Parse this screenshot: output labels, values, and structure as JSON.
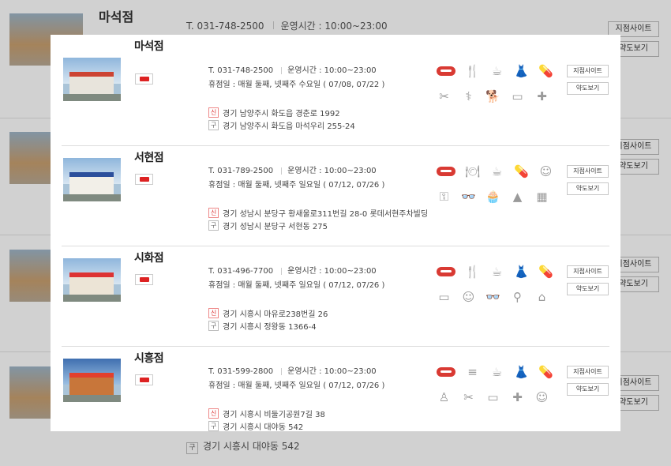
{
  "background": {
    "store_name": "마석점",
    "phone": "T. 031-748-2500",
    "hours": "운영시간 : 10:00~23:00",
    "buttons": {
      "site": "지점사이트",
      "map": "약도보기"
    },
    "addr_badge_old": "구",
    "addr_old": "경기 시흥시 대야동 542"
  },
  "stores": [
    {
      "name": "마석점",
      "phone": "T. 031-748-2500",
      "hours": "운영시간 : 10:00~23:00",
      "holiday": "휴점일 : 매월 둘째, 넷째주 수요일 ( 07/08, 07/22 )",
      "addr_new_badge": "신",
      "addr_new": "경기 남양주시 화도읍 경춘로 1992",
      "addr_old_badge": "구",
      "addr_old": "경기 남양주시 화도읍 마석우리 255-24",
      "icons_r1": [
        "himart-logo",
        "restaurant-icon",
        "cafe-icon",
        "fashion-icon",
        "pharmacy-icon"
      ],
      "icons_r2": [
        "beauty-icon",
        "clinic-icon",
        "pet-icon",
        "bandage-icon",
        "hospital-icon"
      ],
      "btn_site": "지점사이트",
      "btn_map": "약도보기"
    },
    {
      "name": "서현점",
      "phone": "T. 031-789-2500",
      "hours": "운영시간 : 10:00~23:00",
      "holiday": "휴점일 : 매월 둘째, 넷째주 일요일 ( 07/12, 07/26 )",
      "addr_new_badge": "신",
      "addr_new": "경기 성남시 분당구 황새울로311번길 28-0 롯데서현주차빌딩",
      "addr_old_badge": "구",
      "addr_old": "경기 성남시 분당구 서현동 275",
      "icons_r1": [
        "himart-logo",
        "dining-icon",
        "cafe-icon",
        "pharmacy-icon",
        "kids-icon"
      ],
      "icons_r2": [
        "key-icon",
        "glasses-icon",
        "bakery-icon",
        "photo-icon",
        "grid-icon"
      ],
      "btn_site": "지점사이트",
      "btn_map": "약도보기"
    },
    {
      "name": "시화점",
      "phone": "T. 031-496-7700",
      "hours": "운영시간 : 10:00~23:00",
      "holiday": "휴점일 : 매월 둘째, 넷째주 일요일 ( 07/12, 07/26 )",
      "addr_new_badge": "신",
      "addr_new": "경기 시흥시 마유로238번길 26",
      "addr_old_badge": "구",
      "addr_old": "경기 시흥시 정왕동 1366-4",
      "icons_r1": [
        "himart-logo",
        "restaurant-icon",
        "cafe-icon",
        "fashion-icon",
        "pharmacy-icon"
      ],
      "icons_r2": [
        "bandage-icon",
        "kids-icon",
        "glasses-icon",
        "food-icon",
        "laundry-icon"
      ],
      "btn_site": "지점사이트",
      "btn_map": "약도보기"
    },
    {
      "name": "시흥점",
      "phone": "T. 031-599-2800",
      "hours": "운영시간 : 10:00~23:00",
      "holiday": "휴점일 : 매월 둘째, 넷째주 일요일 ( 07/12, 07/26 )",
      "addr_new_badge": "신",
      "addr_new": "경기 시흥시 비둘기공원7길 38",
      "addr_old_badge": "구",
      "addr_old": "경기 시흥시 대야동 542",
      "icons_r1": [
        "himart-logo",
        "burger-icon",
        "cafe-icon",
        "fashion-icon",
        "pharmacy-icon"
      ],
      "icons_r2": [
        "bottle-icon",
        "beauty-icon",
        "bandage-icon",
        "hospital-icon",
        "kids-icon"
      ],
      "btn_site": "지점사이트",
      "btn_map": "약도보기"
    }
  ],
  "icon_glyphs": {
    "restaurant-icon": "🍴",
    "dining-icon": "🍽",
    "cafe-icon": "☕",
    "fashion-icon": "👗",
    "pharmacy-icon": "💊",
    "beauty-icon": "✂",
    "clinic-icon": "⚕",
    "pet-icon": "🐕",
    "bandage-icon": "▭",
    "hospital-icon": "✚",
    "kids-icon": "☺",
    "key-icon": "⚿",
    "glasses-icon": "👓",
    "bakery-icon": "🧁",
    "photo-icon": "▲",
    "grid-icon": "▦",
    "food-icon": "⚲",
    "laundry-icon": "⌂",
    "burger-icon": "≡",
    "bottle-icon": "♙"
  }
}
